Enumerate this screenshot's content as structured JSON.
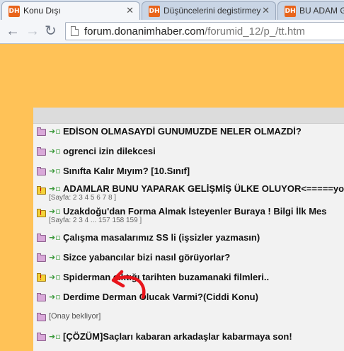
{
  "tabs": [
    {
      "favicon": "DH",
      "title": "Konu Dışı",
      "close": "✕"
    },
    {
      "favicon": "DH",
      "title": "Düşüncelerini degistirmey",
      "close": "✕"
    },
    {
      "favicon": "DH",
      "title": "BU ADAM Gİ",
      "close": ""
    }
  ],
  "toolbar": {
    "back_icon": "back-arrow-icon",
    "forward_icon": "forward-arrow-icon",
    "reload_icon": "reload-icon",
    "url_host": "forum.donanimhaber.com",
    "url_path": "/forumid_12/p_/tt.htm"
  },
  "topics": [
    {
      "title": "EDİSON OLMASAYDİ GUNUMUZDE NELER OLMAZDİ?",
      "hot": false
    },
    {
      "title": "ogrenci izin dilekcesi",
      "hot": false
    },
    {
      "title": "Sınıfta Kalır Mıyım? [10.Sınıf]",
      "hot": false
    },
    {
      "title": "ADAMLAR BUNU YAPARAK GELİŞMİŞ ÜLKE OLUYOR<=====yok",
      "hot": true,
      "pages": "[Sayfa: 2 3 4 5 6 7 8 ]"
    },
    {
      "title": "Uzakdoğu'dan Forma Almak İsteyenler Buraya ! Bilgi İlk Mes",
      "hot": true,
      "pages": "[Sayfa: 2 3 4 ... 157 158 159 ]"
    },
    {
      "title": "Çalışma masalarımız SS li (işsizler yazmasın)",
      "hot": false
    },
    {
      "title": "Sizce yabancılar bizi nasıl görüyorlar?",
      "hot": false
    },
    {
      "title": "Spiderman çıktığı tarihten buzamanaki filmleri..",
      "hot": true
    },
    {
      "title": "Derdime Derman Olucak Varmi?(Ciddi Konu)",
      "hot": false
    },
    {
      "title": "",
      "hot": false,
      "pending": "[Onay bekliyor]"
    },
    {
      "title": "[ÇÖZÜM]Saçları kabaran arkadaşlar kabarmaya son!",
      "hot": false
    }
  ],
  "annotation": {
    "color": "#e8141b",
    "icon": "red-hand-drawn-arrow-icon"
  },
  "colors": {
    "page_bg": "#ffc257",
    "panel_bg": "#f2f2f2"
  }
}
